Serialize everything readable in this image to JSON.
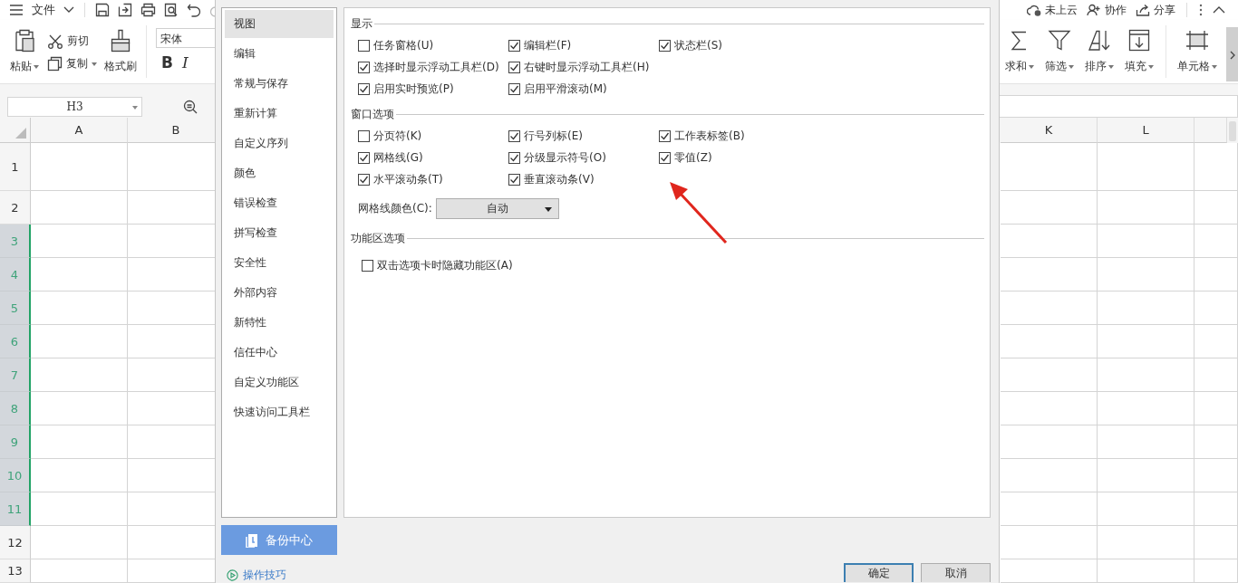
{
  "toolbar": {
    "menu": "文件",
    "cloud": "未上云",
    "collab": "协作",
    "share": "分享"
  },
  "ribbon": {
    "paste": "粘贴",
    "cut": "剪切",
    "copy": "复制",
    "format_painter": "格式刷",
    "font": "宋体",
    "bold": "B",
    "italic": "I",
    "sum": "求和",
    "filter": "筛选",
    "sort": "排序",
    "fill": "填充",
    "cell": "单元格"
  },
  "name_box": "H3",
  "sheet": {
    "columns": [
      {
        "label": "A"
      },
      {
        "label": "B"
      },
      {
        "label": "K"
      },
      {
        "label": "L"
      }
    ],
    "rows": [
      {
        "label": "1",
        "selected": false
      },
      {
        "label": "2",
        "selected": false
      },
      {
        "label": "3",
        "selected": true
      },
      {
        "label": "4",
        "selected": true
      },
      {
        "label": "5",
        "selected": true
      },
      {
        "label": "6",
        "selected": true
      },
      {
        "label": "7",
        "selected": true
      },
      {
        "label": "8",
        "selected": true
      },
      {
        "label": "9",
        "selected": true
      },
      {
        "label": "10",
        "selected": true
      },
      {
        "label": "11",
        "selected": true
      },
      {
        "label": "12",
        "selected": false
      },
      {
        "label": "13",
        "selected": false
      }
    ]
  },
  "dialog": {
    "nav": [
      {
        "label": "视图",
        "selected": true
      },
      {
        "label": "编辑",
        "selected": false
      },
      {
        "label": "常规与保存",
        "selected": false
      },
      {
        "label": "重新计算",
        "selected": false
      },
      {
        "label": "自定义序列",
        "selected": false
      },
      {
        "label": "颜色",
        "selected": false
      },
      {
        "label": "错误检查",
        "selected": false
      },
      {
        "label": "拼写检查",
        "selected": false
      },
      {
        "label": "安全性",
        "selected": false
      },
      {
        "label": "外部内容",
        "selected": false
      },
      {
        "label": "新特性",
        "selected": false
      },
      {
        "label": "信任中心",
        "selected": false
      },
      {
        "label": "自定义功能区",
        "selected": false
      },
      {
        "label": "快速访问工具栏",
        "selected": false
      }
    ],
    "sections": [
      {
        "title": "显示",
        "rows": [
          [
            {
              "label": "任务窗格(U)",
              "checked": false
            },
            {
              "label": "编辑栏(F)",
              "checked": true
            },
            {
              "label": "状态栏(S)",
              "checked": true
            }
          ],
          [
            {
              "label": "选择时显示浮动工具栏(D)",
              "checked": true
            },
            {
              "label": "右键时显示浮动工具栏(H)",
              "checked": true
            }
          ],
          [
            {
              "label": "启用实时预览(P)",
              "checked": true
            },
            {
              "label": "启用平滑滚动(M)",
              "checked": true
            }
          ]
        ]
      },
      {
        "title": "窗口选项",
        "rows": [
          [
            {
              "label": "分页符(K)",
              "checked": false
            },
            {
              "label": "行号列标(E)",
              "checked": true
            },
            {
              "label": "工作表标签(B)",
              "checked": true
            }
          ],
          [
            {
              "label": "网格线(G)",
              "checked": true
            },
            {
              "label": "分级显示符号(O)",
              "checked": true
            },
            {
              "label": "零值(Z)",
              "checked": true
            }
          ],
          [
            {
              "label": "水平滚动条(T)",
              "checked": true
            },
            {
              "label": "垂直滚动条(V)",
              "checked": true
            }
          ]
        ],
        "grid_color": {
          "label": "网格线颜色(C):",
          "value": "自动"
        }
      },
      {
        "title": "功能区选项",
        "rows": [
          [
            {
              "label": "双击选项卡时隐藏功能区(A)",
              "checked": false
            }
          ]
        ]
      }
    ],
    "backup": "备份中心",
    "tips": "操作技巧",
    "buttons": [
      {
        "label": "确定",
        "default": true
      },
      {
        "label": "取消",
        "default": false
      }
    ]
  }
}
